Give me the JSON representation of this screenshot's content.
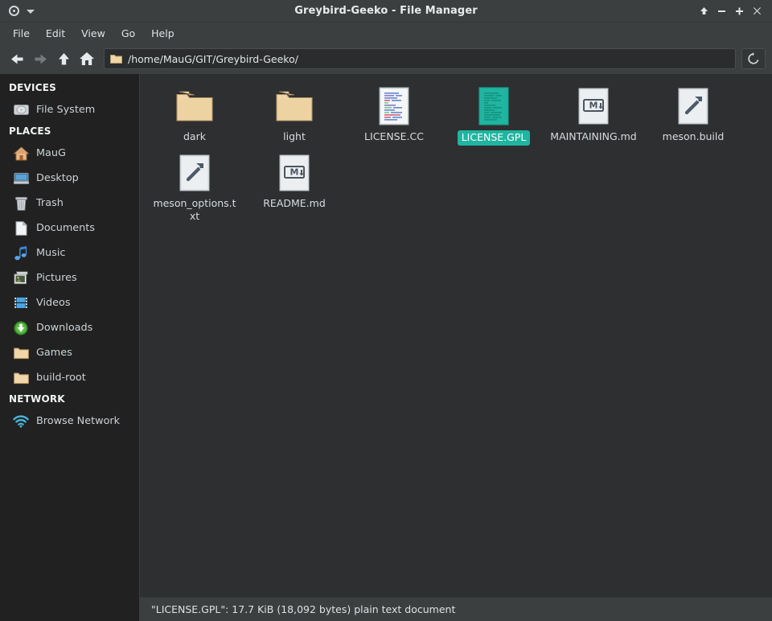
{
  "window": {
    "title": "Greybird-Geeko - File Manager",
    "app_menu_icon": "app-circle-icon",
    "app_menu_chevron": "chevron-down-icon",
    "controls": [
      {
        "name": "shade-button",
        "glyph": "arrow-up-icon",
        "label": "Shade"
      },
      {
        "name": "minimize-button",
        "glyph": "minus-icon",
        "label": "Minimize"
      },
      {
        "name": "maximize-button",
        "glyph": "plus-icon",
        "label": "Maximize"
      },
      {
        "name": "close-button",
        "glyph": "close-icon",
        "label": "Close"
      }
    ]
  },
  "menubar": {
    "items": [
      {
        "label": "File"
      },
      {
        "label": "Edit"
      },
      {
        "label": "View"
      },
      {
        "label": "Go"
      },
      {
        "label": "Help"
      }
    ]
  },
  "toolbar": {
    "buttons": [
      {
        "name": "back-button",
        "icon": "arrow-left-icon",
        "enabled": true
      },
      {
        "name": "forward-button",
        "icon": "arrow-right-icon",
        "enabled": false
      },
      {
        "name": "up-button",
        "icon": "arrow-up-icon",
        "enabled": true
      },
      {
        "name": "home-button",
        "icon": "home-icon",
        "enabled": true
      }
    ],
    "path_value": "/home/MauG/GIT/Greybird-Geeko/",
    "path_placeholder": "Location",
    "path_icon": "folder-icon",
    "reload_icon": "reload-icon"
  },
  "sidebar": {
    "groups": [
      {
        "header": "DEVICES",
        "items": [
          {
            "label": "File System",
            "icon": "harddisk-icon"
          }
        ]
      },
      {
        "header": "PLACES",
        "items": [
          {
            "label": "MauG",
            "icon": "home-icon"
          },
          {
            "label": "Desktop",
            "icon": "desktop-icon"
          },
          {
            "label": "Trash",
            "icon": "trash-icon"
          },
          {
            "label": "Documents",
            "icon": "document-icon"
          },
          {
            "label": "Music",
            "icon": "music-note-icon"
          },
          {
            "label": "Pictures",
            "icon": "pictures-icon"
          },
          {
            "label": "Videos",
            "icon": "film-icon"
          },
          {
            "label": "Downloads",
            "icon": "download-arrow-icon"
          },
          {
            "label": "Games",
            "icon": "folder-icon"
          },
          {
            "label": "build-root",
            "icon": "folder-icon"
          }
        ]
      },
      {
        "header": "NETWORK",
        "items": [
          {
            "label": "Browse Network",
            "icon": "network-wifi-icon"
          }
        ]
      }
    ]
  },
  "files": [
    {
      "name": "dark",
      "icon": "folder-icon",
      "type": "folder",
      "selected": false
    },
    {
      "name": "light",
      "icon": "folder-icon",
      "type": "folder",
      "selected": false
    },
    {
      "name": "LICENSE.CC",
      "icon": "text-document-icon",
      "type": "file",
      "selected": false
    },
    {
      "name": "LICENSE.GPL",
      "icon": "text-document-icon",
      "type": "file",
      "selected": true
    },
    {
      "name": "MAINTAINING.md",
      "icon": "markdown-document-icon",
      "type": "file",
      "selected": false
    },
    {
      "name": "meson.build",
      "icon": "build-hammer-icon",
      "type": "file",
      "selected": false
    },
    {
      "name": "meson_options.txt",
      "icon": "build-hammer-icon",
      "type": "file",
      "selected": false
    },
    {
      "name": "README.md",
      "icon": "markdown-document-icon",
      "type": "file",
      "selected": false
    }
  ],
  "statusbar": {
    "text": "\"LICENSE.GPL\": 17.7 KiB (18,092 bytes) plain text document"
  },
  "colors": {
    "titlebar_bg": "#3b3f40",
    "sidebar_bg": "#212121",
    "content_bg": "#2d2f31",
    "selection": "#1fb5a0",
    "text_primary": "#dfe3e5",
    "folder": "#f0d6a8"
  }
}
